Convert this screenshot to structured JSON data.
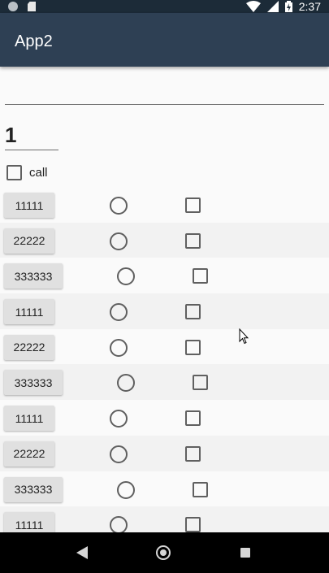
{
  "status_bar": {
    "time": "2:37",
    "icons": [
      "notification-dot-icon",
      "sd-card-icon",
      "wifi-icon",
      "cellular-icon",
      "battery-charging-icon"
    ]
  },
  "app_bar": {
    "title": "App2"
  },
  "form": {
    "text_value": "",
    "count_value": "1",
    "call_label": "call",
    "call_checked": false
  },
  "rows": [
    {
      "button": "11111"
    },
    {
      "button": "22222"
    },
    {
      "button": "333333"
    },
    {
      "button": "11111"
    },
    {
      "button": "22222"
    },
    {
      "button": "333333"
    },
    {
      "button": "11111"
    },
    {
      "button": "22222"
    },
    {
      "button": "333333"
    },
    {
      "button": "11111"
    }
  ],
  "nav_bar": {
    "icons": [
      "back-icon",
      "home-icon",
      "recents-icon"
    ]
  },
  "colors": {
    "app_bar": "#2e4054",
    "status_bar": "#1c2b38",
    "row_alt": "#f2f2f2",
    "button": "#e0e0e0"
  }
}
